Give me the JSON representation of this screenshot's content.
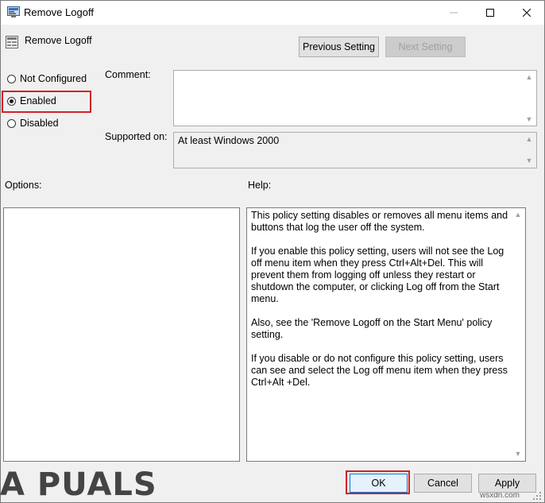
{
  "window": {
    "title": "Remove Logoff",
    "controls": {
      "minimize": "minimize-icon",
      "maximize": "maximize-icon",
      "close": "close-icon"
    }
  },
  "header": {
    "setting_name": "Remove Logoff",
    "previous_label": "Previous Setting",
    "next_label": "Next Setting"
  },
  "state": {
    "options": [
      {
        "label": "Not Configured",
        "selected": false
      },
      {
        "label": "Enabled",
        "selected": true
      },
      {
        "label": "Disabled",
        "selected": false
      }
    ]
  },
  "fields": {
    "comment_label": "Comment:",
    "comment_value": "",
    "supported_label": "Supported on:",
    "supported_value": "At least Windows 2000"
  },
  "panels": {
    "options_label": "Options:",
    "help_label": "Help:",
    "help_paragraphs": [
      "This policy setting disables or removes all menu items and buttons that log the user off the system.",
      "If you enable this policy setting, users will not see the Log off menu item when they press Ctrl+Alt+Del. This will prevent them from logging off unless they restart or shutdown the computer, or clicking Log off from the Start menu.",
      "Also, see the 'Remove Logoff on the Start Menu' policy setting.",
      "If you disable or do not configure this policy setting, users can see and select the Log off menu item when they press Ctrl+Alt +Del."
    ]
  },
  "footer": {
    "ok_label": "OK",
    "cancel_label": "Cancel",
    "apply_label": "Apply"
  },
  "watermark": {
    "text": "A PUALS",
    "site": "wsxdn.com"
  },
  "colors": {
    "highlight": "#d0212b",
    "accent": "#0078d7"
  }
}
